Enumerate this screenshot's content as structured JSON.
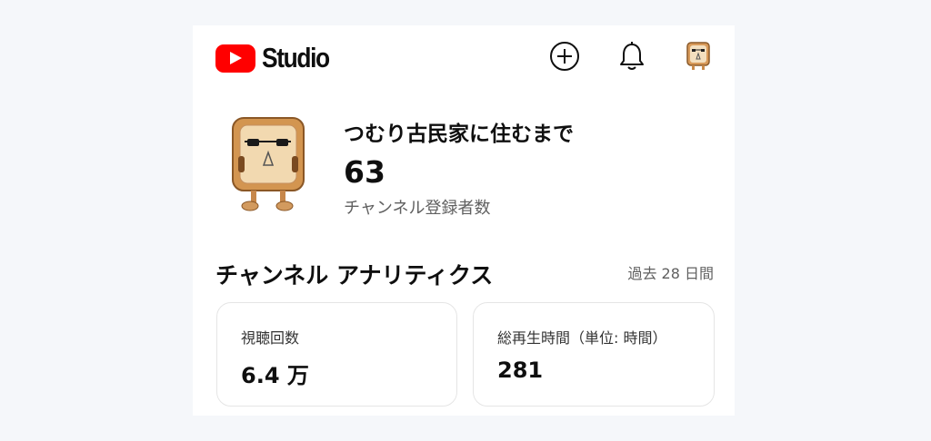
{
  "header": {
    "logo_text": "Studio",
    "create_icon": "add-circle-icon",
    "notifications_icon": "bell-icon"
  },
  "channel": {
    "name": "つむり古民家に住むまで",
    "subscriber_count": "63",
    "subscriber_label": "チャンネル登録者数"
  },
  "analytics": {
    "title": "チャンネル アナリティクス",
    "period": "過去 28 日間",
    "cards": [
      {
        "label": "視聴回数",
        "value": "6.4 万"
      },
      {
        "label": "総再生時間（単位: 時間）",
        "value": "281"
      }
    ]
  },
  "colors": {
    "brand_red": "#ff0000",
    "background": "#f5f7fa",
    "card_border": "#e5e5e5",
    "secondary_text": "#606060"
  }
}
